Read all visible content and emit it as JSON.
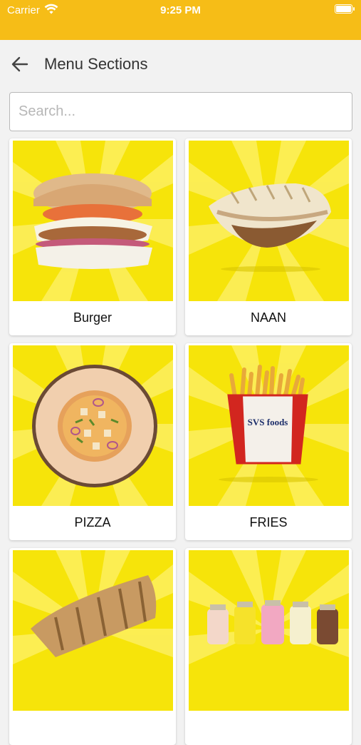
{
  "status_bar": {
    "carrier": "Carrier",
    "time": "9:25 PM"
  },
  "header": {
    "title": "Menu Sections"
  },
  "search": {
    "placeholder": "Search..."
  },
  "sections": [
    {
      "label": "Burger"
    },
    {
      "label": "NAAN"
    },
    {
      "label": "PIZZA"
    },
    {
      "label": "FRIES"
    },
    {
      "label": ""
    },
    {
      "label": ""
    }
  ],
  "colors": {
    "status_bar": "#f6bd17",
    "card_background": "#f6e40a"
  },
  "fries_box_text": "SVS foods"
}
